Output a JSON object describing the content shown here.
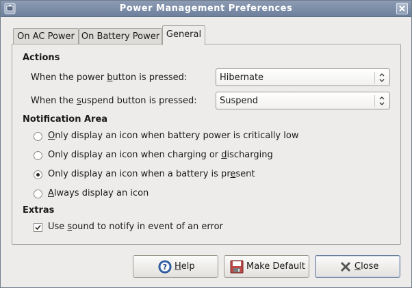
{
  "window": {
    "title": "Power Management Preferences"
  },
  "tabs": [
    {
      "label": "On AC Power"
    },
    {
      "label": "On Battery Power"
    },
    {
      "label": "General",
      "active": true
    }
  ],
  "actions": {
    "heading": "Actions",
    "power_button": {
      "label_pre": "When the power ",
      "label_mn": "b",
      "label_post": "utton is pressed:",
      "value": "Hibernate"
    },
    "suspend_button": {
      "label_pre": "When the ",
      "label_mn": "s",
      "label_post": "uspend button is pressed:",
      "value": "Suspend"
    }
  },
  "notification": {
    "heading": "Notification Area",
    "options": [
      {
        "pre": "",
        "mn": "O",
        "post": "nly display an icon when battery power is critically low",
        "selected": false
      },
      {
        "pre": "Only display an icon when charging or ",
        "mn": "d",
        "post": "ischarging",
        "selected": false
      },
      {
        "pre": "Only display an icon when a battery is pr",
        "mn": "e",
        "post": "sent",
        "selected": true
      },
      {
        "pre": "",
        "mn": "A",
        "post": "lways display an icon",
        "selected": false
      }
    ]
  },
  "extras": {
    "heading": "Extras",
    "sound": {
      "pre": "Use ",
      "mn": "s",
      "post": "ound to notify in event of an error",
      "checked": true
    }
  },
  "buttons": {
    "help": {
      "mn": "H",
      "post": "elp",
      "icon": "help-icon"
    },
    "make_default": {
      "label": "Make Default",
      "icon": "floppy-disk-icon"
    },
    "close": {
      "mn": "C",
      "post": "lose",
      "icon": "close-icon"
    }
  },
  "colors": {
    "titlebar": "#7b8ca8",
    "window_bg": "#edeceb",
    "help_icon": "#3b6db3"
  }
}
